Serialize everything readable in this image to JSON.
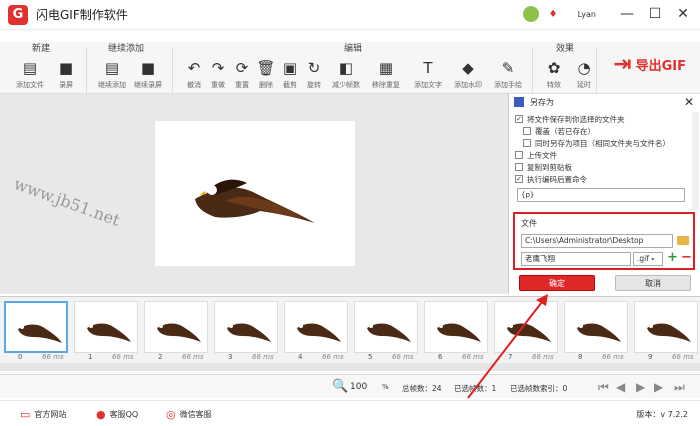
{
  "app": {
    "title": "闪电GIF制作软件",
    "logo": "G",
    "username": "Lyan"
  },
  "window": {
    "minimize": "—",
    "maximize": "☐",
    "close": "✕"
  },
  "toolbar": {
    "groups": {
      "new": "新建",
      "continue": "继续添加",
      "edit": "编辑",
      "effects": "效果"
    },
    "tools": [
      {
        "label": "添加文件",
        "icon": "file-icon",
        "glyph": "▤"
      },
      {
        "label": "录屏",
        "icon": "camera-icon",
        "glyph": "■"
      },
      {
        "label": "继续添加",
        "icon": "file-add-icon",
        "glyph": "▤"
      },
      {
        "label": "继续录屏",
        "icon": "camera-icon",
        "glyph": "■"
      },
      {
        "label": "撤消",
        "icon": "undo-icon",
        "glyph": "↶"
      },
      {
        "label": "重做",
        "icon": "redo-icon",
        "glyph": "↷"
      },
      {
        "label": "重置",
        "icon": "reset-icon",
        "glyph": "⟳"
      },
      {
        "label": "删除",
        "icon": "trash-icon",
        "glyph": "🗑"
      },
      {
        "label": "截剪",
        "icon": "crop-icon",
        "glyph": "▣"
      },
      {
        "label": "旋转",
        "icon": "rotate-icon",
        "glyph": "↻"
      },
      {
        "label": "减少帧数",
        "icon": "reduce-frames-icon",
        "glyph": "◧"
      },
      {
        "label": "移除重复",
        "icon": "remove-duplicate-icon",
        "glyph": "▦"
      },
      {
        "label": "添加文字",
        "icon": "text-icon",
        "glyph": "T"
      },
      {
        "label": "添加水印",
        "icon": "watermark-icon",
        "glyph": "◆"
      },
      {
        "label": "添加手绘",
        "icon": "brush-icon",
        "glyph": "✎"
      },
      {
        "label": "特效",
        "icon": "effects-icon",
        "glyph": "✿"
      },
      {
        "label": "延时",
        "icon": "timer-icon",
        "glyph": "◔"
      }
    ],
    "export": "导出GIF"
  },
  "watermark": "www.jb51.net",
  "panel": {
    "title": "另存为",
    "options": [
      {
        "label": "将文件保存到你选择的文件夹",
        "checked": true,
        "indent": false
      },
      {
        "label": "覆盖（若已存在）",
        "checked": false,
        "indent": true
      },
      {
        "label": "同时另存为项目（相同文件夹与文件名）",
        "checked": false,
        "indent": true
      },
      {
        "label": "上传文件",
        "checked": false,
        "indent": false
      },
      {
        "label": "复制到剪贴板",
        "checked": false,
        "indent": false
      },
      {
        "label": "执行编码后置命令",
        "checked": true,
        "indent": false
      }
    ],
    "command_value": "{p}",
    "file_label": "文件",
    "path_value": "C:\\Users\\Administrator\\Desktop",
    "name_value": "老鹰飞翔",
    "ext_value": ".gif",
    "ok": "确定",
    "cancel": "取消"
  },
  "frames": [
    {
      "index": "0",
      "ms": "66 ms"
    },
    {
      "index": "1",
      "ms": "66 ms"
    },
    {
      "index": "2",
      "ms": "66 ms"
    },
    {
      "index": "3",
      "ms": "66 ms"
    },
    {
      "index": "4",
      "ms": "66 ms"
    },
    {
      "index": "5",
      "ms": "66 ms"
    },
    {
      "index": "6",
      "ms": "66 ms"
    },
    {
      "index": "7",
      "ms": "66 ms"
    },
    {
      "index": "8",
      "ms": "66 ms"
    },
    {
      "index": "9",
      "ms": "66 ms"
    }
  ],
  "status": {
    "zoom": "100",
    "zoom_unit": "%",
    "total_frames": "总帧数：24",
    "selected_frames": "已选帧数：1",
    "selected_index": "已选帧数索引：0"
  },
  "footer": {
    "website": "官方网站",
    "qq": "客服QQ",
    "wechat": "微信客服",
    "version": "版本：v 7.2.2"
  },
  "colors": {
    "accent": "#e03030",
    "selection": "#59a8e8"
  }
}
